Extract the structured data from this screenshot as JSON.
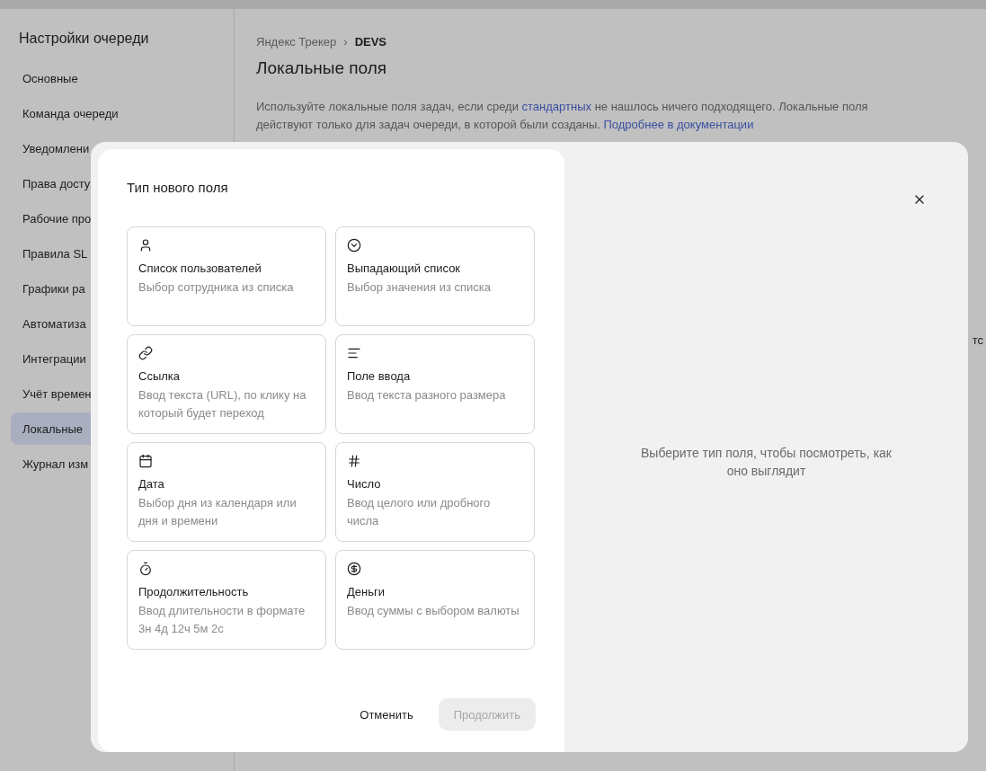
{
  "page": {
    "sidebar": {
      "title": "Настройки очереди",
      "items": [
        {
          "label": "Основные",
          "selected": false
        },
        {
          "label": "Команда очереди",
          "selected": false
        },
        {
          "label": "Уведомлени",
          "selected": false
        },
        {
          "label": "Права досту",
          "selected": false
        },
        {
          "label": "Рабочие про",
          "selected": false
        },
        {
          "label": "Правила SL",
          "selected": false
        },
        {
          "label": "Графики ра",
          "selected": false
        },
        {
          "label": "Автоматиза",
          "selected": false
        },
        {
          "label": "Интеграции",
          "selected": false
        },
        {
          "label": "Учёт времен",
          "selected": false
        },
        {
          "label": "Локальные",
          "selected": true
        },
        {
          "label": "Журнал изм",
          "selected": false
        }
      ]
    },
    "breadcrumbs": [
      {
        "label": "Яндекс Трекер",
        "current": false
      },
      {
        "label": "DEVS",
        "current": true
      }
    ],
    "breadcrumb_separator": "›",
    "title": "Локальные поля",
    "description": [
      {
        "text": "Используйте локальные поля задач, если среди ",
        "link": false
      },
      {
        "text": "стандартных",
        "link": true
      },
      {
        "text": " не нашлось ничего подходящего. Локальные поля действуют только для задач очереди, в которой были созданы. ",
        "link": false
      },
      {
        "text": "Подробнее в документации",
        "link": true
      }
    ],
    "cut_text": "тс"
  },
  "dialog": {
    "title": "Тип нового поля",
    "options": [
      {
        "kind": "user",
        "title": "Список пользователей",
        "description": "Выбор сотрудника из списка",
        "selected": false
      },
      {
        "kind": "select",
        "title": "Выпадающий список",
        "description": "Выбор значения из списка",
        "selected": false
      },
      {
        "kind": "link",
        "title": "Ссылка",
        "description": "Ввод текста (URL), по клику на который будет переход",
        "selected": false
      },
      {
        "kind": "text",
        "title": "Поле ввода",
        "description": "Ввод текста разного размера",
        "selected": false
      },
      {
        "kind": "date",
        "title": "Дата",
        "description": "Выбор дня из календаря или дня и времени",
        "selected": false
      },
      {
        "kind": "number",
        "title": "Число",
        "description": "Ввод целого или дробного числа",
        "selected": false
      },
      {
        "kind": "duration",
        "title": "Продолжительность",
        "description": "Ввод длительности в формате 3н 4д 12ч 5м 2с",
        "selected": false
      },
      {
        "kind": "money",
        "title": "Деньги",
        "description": "Ввод суммы с выбором валюты",
        "selected": false
      }
    ],
    "preview_hint": "Выберите тип поля, чтобы посмотреть, как оно выглядит",
    "cancel_button": {
      "label": "Отменить"
    },
    "continue_button": {
      "label": "Продолжить",
      "disabled": true
    }
  }
}
